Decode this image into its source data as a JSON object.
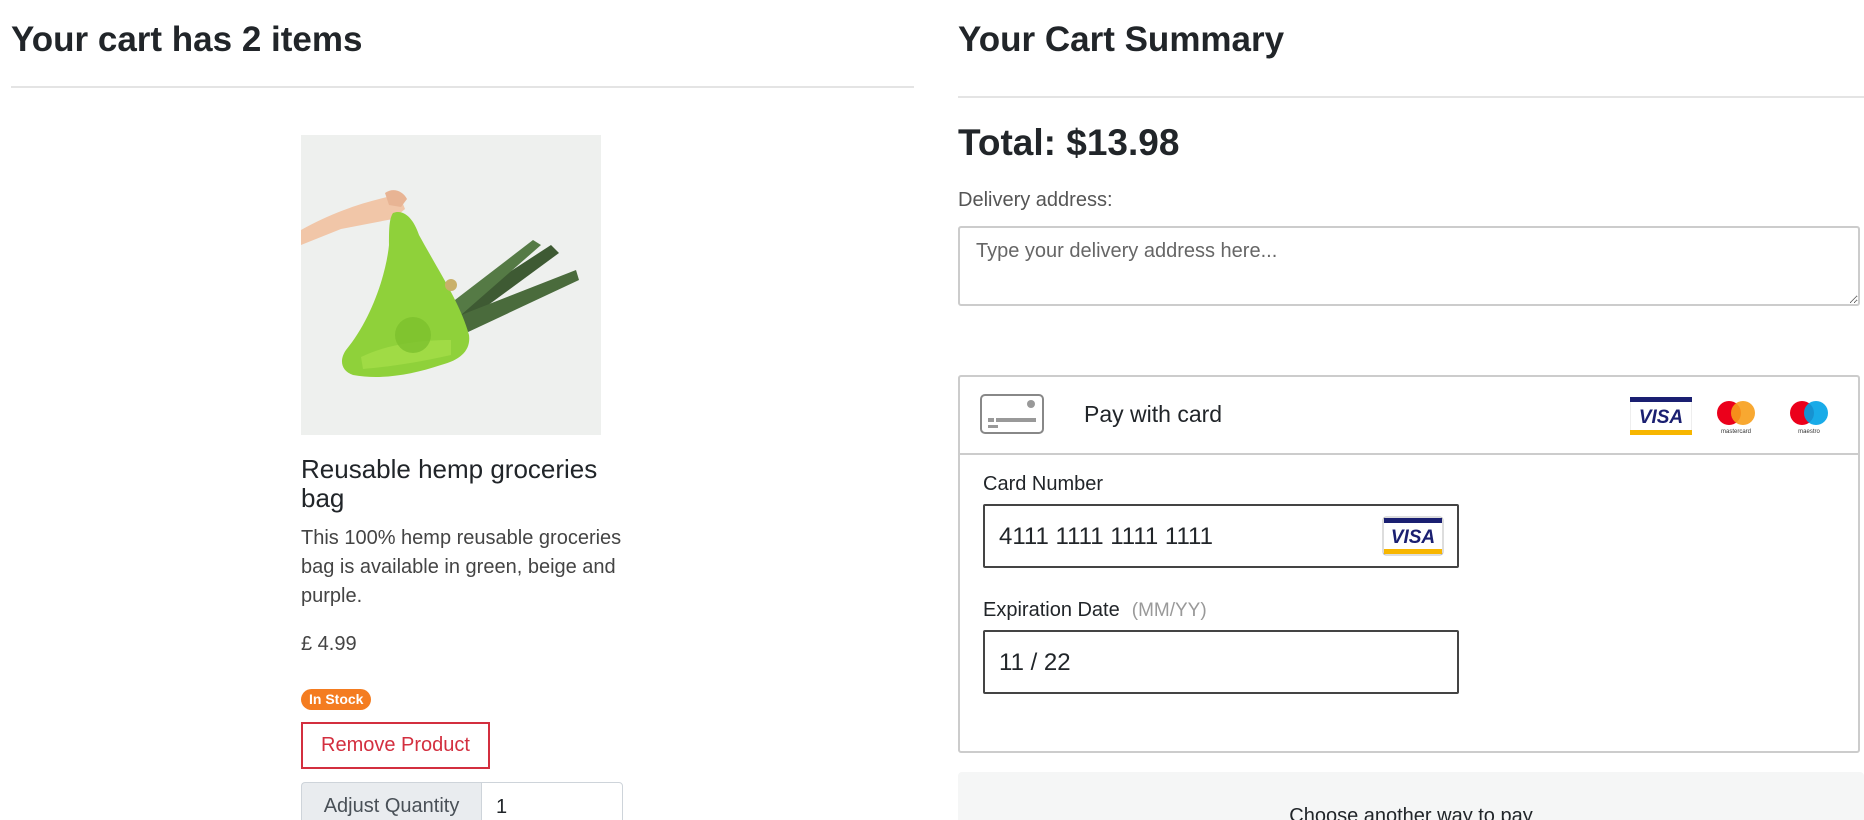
{
  "cart": {
    "title": "Your cart has 2 items",
    "product": {
      "name": "Reusable hemp groceries bag",
      "description": "This 100% hemp reusable groceries bag is available in green, beige and purple.",
      "price": "£ 4.99",
      "stock_badge": "In Stock",
      "remove_label": "Remove Product",
      "quantity_label": "Adjust Quantity",
      "quantity_value": "1",
      "image_icon": "hemp-bag-photo"
    }
  },
  "summary": {
    "title": "Your Cart Summary",
    "total": "Total: $13.98",
    "address_label": "Delivery address:",
    "address_placeholder": "Type your delivery address here...",
    "payment": {
      "header_label": "Pay with card",
      "card_icon": "card-icon",
      "brand_logos": [
        "visa",
        "mastercard",
        "maestro"
      ],
      "card_number_label": "Card Number",
      "card_number_value": "4111 1111 1111 1111",
      "detected_brand": "visa",
      "expiration_label": "Expiration Date",
      "expiration_hint": "(MM/YY)",
      "expiration_value": "11 / 22"
    },
    "another_way_label": "Choose another way to pay"
  },
  "colors": {
    "badge": "#f47c20",
    "remove_button": "#d32f3f",
    "visa_blue": "#1a1f71",
    "visa_gold": "#f7b600",
    "mastercard_red": "#eb001b",
    "mastercard_orange": "#f79e1b",
    "maestro_blue": "#00a2e5"
  }
}
